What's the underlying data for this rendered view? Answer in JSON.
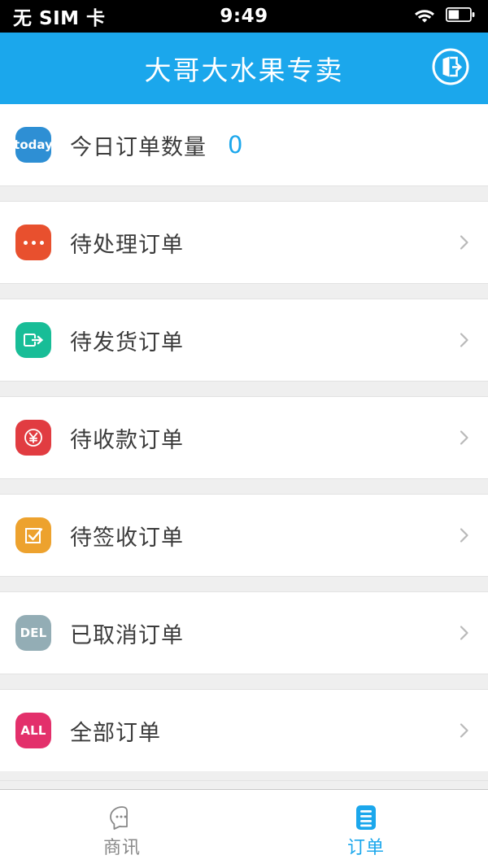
{
  "status_bar": {
    "carrier": "无 SIM 卡",
    "time": "9:49",
    "wifi_icon": "wifi-icon",
    "battery_icon": "battery-icon"
  },
  "header": {
    "title": "大哥大水果专卖",
    "background_color": "#1ba7ec",
    "action_icon": "logout-icon"
  },
  "list": {
    "rows": [
      {
        "id": "today-order-count",
        "label": "今日订单数量",
        "icon_text": "today",
        "icon_name": "today-badge-icon",
        "icon_color": "#2e8fd4",
        "count": "0",
        "count_color": "#1ba7ec",
        "has_chevron": false
      },
      {
        "id": "pending-orders",
        "label": "待处理订单",
        "icon_text": "",
        "icon_name": "three-dots-icon",
        "icon_color": "#e8502e",
        "count": "",
        "has_chevron": true
      },
      {
        "id": "to-ship-orders",
        "label": "待发货订单",
        "icon_text": "",
        "icon_name": "ship-export-icon",
        "icon_color": "#18bd97",
        "count": "",
        "has_chevron": true
      },
      {
        "id": "to-collect-orders",
        "label": "待收款订单",
        "icon_text": "",
        "icon_name": "yuan-coin-icon",
        "icon_color": "#e13c41",
        "count": "",
        "has_chevron": true
      },
      {
        "id": "to-sign-orders",
        "label": "待签收订单",
        "icon_text": "",
        "icon_name": "check-box-icon",
        "icon_color": "#eda22e",
        "count": "",
        "has_chevron": true
      },
      {
        "id": "cancelled-orders",
        "label": "已取消订单",
        "icon_text": "DEL",
        "icon_name": "delete-badge-icon",
        "icon_color": "#93adb5",
        "count": "",
        "has_chevron": true
      },
      {
        "id": "all-orders",
        "label": "全部订单",
        "icon_text": "ALL",
        "icon_name": "all-badge-icon",
        "icon_color": "#e3306b",
        "count": "",
        "has_chevron": true
      }
    ]
  },
  "tabbar": {
    "tabs": [
      {
        "id": "news",
        "label": "商讯",
        "icon_name": "chat-bubble-icon",
        "active": false,
        "color": "#888888"
      },
      {
        "id": "orders",
        "label": "订单",
        "icon_name": "list-document-icon",
        "active": true,
        "color": "#1ba7ec"
      }
    ]
  }
}
